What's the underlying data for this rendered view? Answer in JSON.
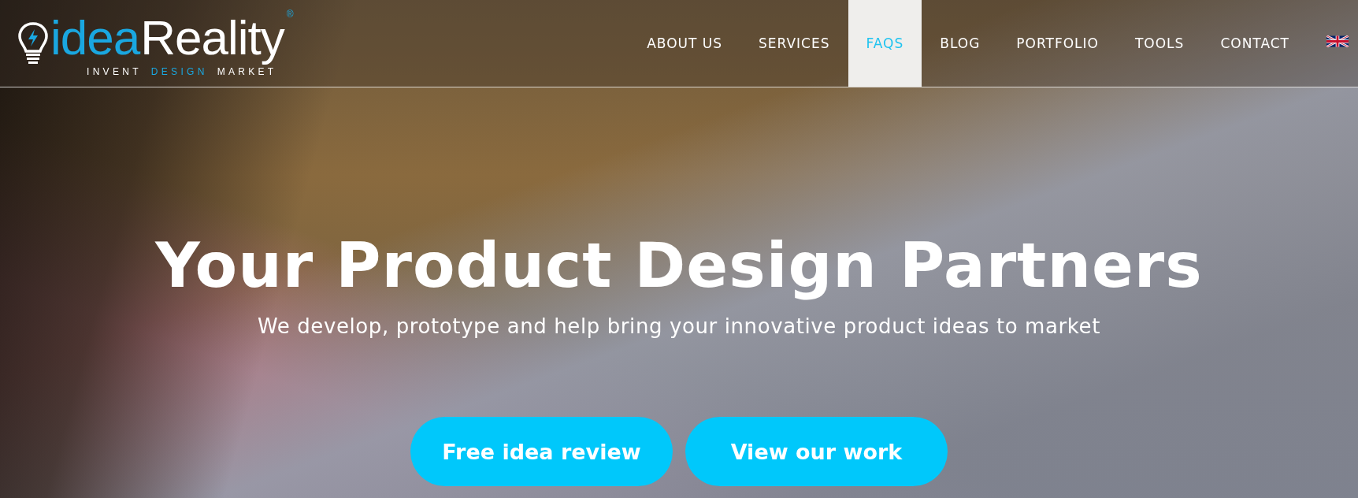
{
  "logo": {
    "name_parts": [
      {
        "text": "idea",
        "accent": true
      },
      {
        "text": "Reality",
        "accent": false
      }
    ],
    "registered": "®",
    "tagline": [
      {
        "text": "INVENT",
        "accent": false
      },
      {
        "text": "DESIGN",
        "accent": true
      },
      {
        "text": "MARKET",
        "accent": false
      }
    ]
  },
  "nav": {
    "items": [
      {
        "label": "ABOUT US",
        "selected": false
      },
      {
        "label": "SERVICES",
        "selected": false
      },
      {
        "label": "FAQS",
        "selected": true
      },
      {
        "label": "BLOG",
        "selected": false
      },
      {
        "label": "PORTFOLIO",
        "selected": false
      },
      {
        "label": "TOOLS",
        "selected": false
      },
      {
        "label": "CONTACT",
        "selected": false
      }
    ]
  },
  "hero": {
    "title": "Your Product Design Partners",
    "subtitle": "We develop, prototype and help bring your innovative product ideas to market",
    "buttons": [
      "Free idea review",
      "View our work"
    ]
  }
}
